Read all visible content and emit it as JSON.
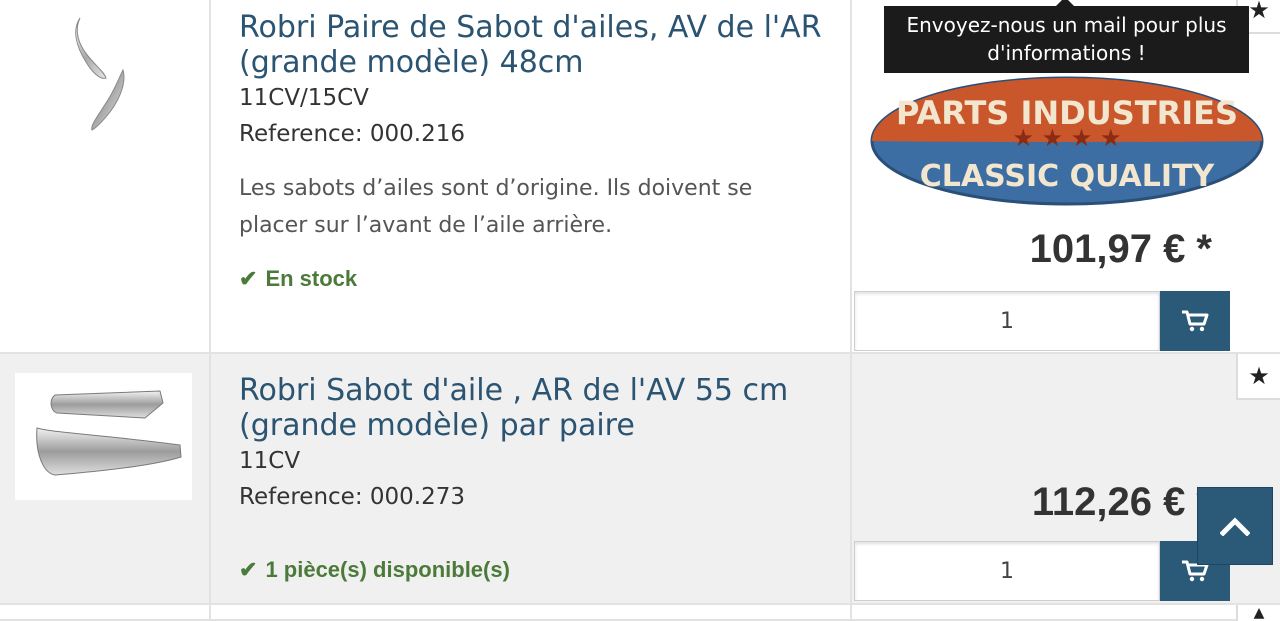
{
  "products": [
    {
      "title": "Robri Paire de Sabot d'ailes, AV de l'AR (grande modèle) 48cm",
      "subtitle": "11CV/15CV",
      "reference": "Reference: 000.216",
      "description": "Les sabots d’ailes sont d’origine. Ils doivent se placer sur l’avant de l’aile arrière.",
      "stock": "En stock",
      "price": "101,97 € *",
      "quantity": "1"
    },
    {
      "title": "Robri Sabot d'aile , AR de l'AV 55 cm (grande modèle) par paire",
      "subtitle": "11CV",
      "reference": "Reference: 000.273",
      "stock": "1 pièce(s) disponible(s)",
      "price": "112,26 € *",
      "quantity": "1"
    }
  ],
  "tooltip": {
    "text": "Envoyez-nous un mail pour plus d'informations !"
  },
  "logo": {
    "top_text": "PARTS INDUSTRIES",
    "bottom_text": "CLASSIC QUALITY",
    "stars": "★ ★ ★ ★"
  },
  "icons": {
    "favorite": "star-icon",
    "cart": "cart-icon",
    "stock": "check-icon",
    "scroll": "chevron-up-icon"
  },
  "colors": {
    "title": "#2b5472",
    "stock": "#4b7a3a",
    "button": "#2b5a79",
    "logo_orange": "#c9572b",
    "logo_blue": "#3d6ea3"
  }
}
